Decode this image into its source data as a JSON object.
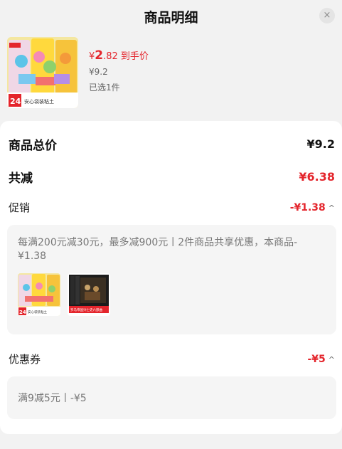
{
  "header": {
    "title": "商品明细",
    "close_glyph": "×"
  },
  "product": {
    "price_yen": "¥",
    "price_int": "2",
    "price_dec": ".82",
    "price_tag": "到手价",
    "original_price": "¥9.2",
    "selected": "已选1件",
    "image_badge": "24",
    "image_caption": "安心袋装粘土"
  },
  "summary": {
    "total_label": "商品总价",
    "total_value": "¥9.2",
    "reduce_label": "共减",
    "reduce_value": "¥6.38"
  },
  "promo": {
    "label": "促销",
    "value": "-¥1.38",
    "text": "每满200元减30元，最多减900元丨2件商品共享优惠，本商品-¥1.38",
    "thumb1_badge": "24",
    "thumb1_caption": "安心袋装粘土",
    "thumb2_caption": "罗马帝国兴亡史六部曲"
  },
  "coupon": {
    "label": "优惠券",
    "value": "-¥5",
    "text": "满9减5元丨-¥5"
  },
  "icons": {
    "chevron": "chevron-up-icon",
    "close": "close-icon"
  },
  "colors": {
    "accent": "#e4252c",
    "background": "#f2f2f2",
    "card": "#ffffff"
  }
}
